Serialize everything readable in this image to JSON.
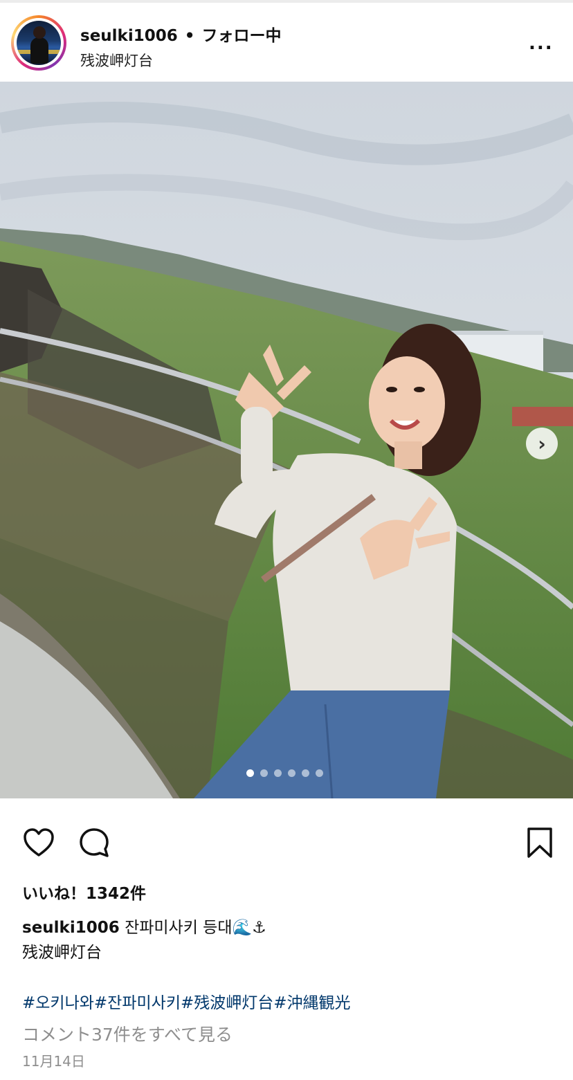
{
  "header": {
    "username": "seulki1006",
    "separator": "•",
    "follow_status": "フォロー中",
    "location": "残波岬灯台",
    "more_label": "..."
  },
  "photo": {
    "carousel_total": 6,
    "carousel_index": 1,
    "next_label": "›"
  },
  "actions": {
    "icons": [
      "heart-icon",
      "comment-icon",
      "bookmark-icon"
    ]
  },
  "likes_text": "いいね！1342件",
  "caption": {
    "username": "seulki1006",
    "text": "잔파미사키 등대🌊⚓",
    "line2": "残波岬灯台"
  },
  "hashtags": "#오키나와#잔파미사키#残波岬灯台#沖縄観光",
  "comments_link": "コメント37件をすべて見る",
  "date": "11月14日"
}
